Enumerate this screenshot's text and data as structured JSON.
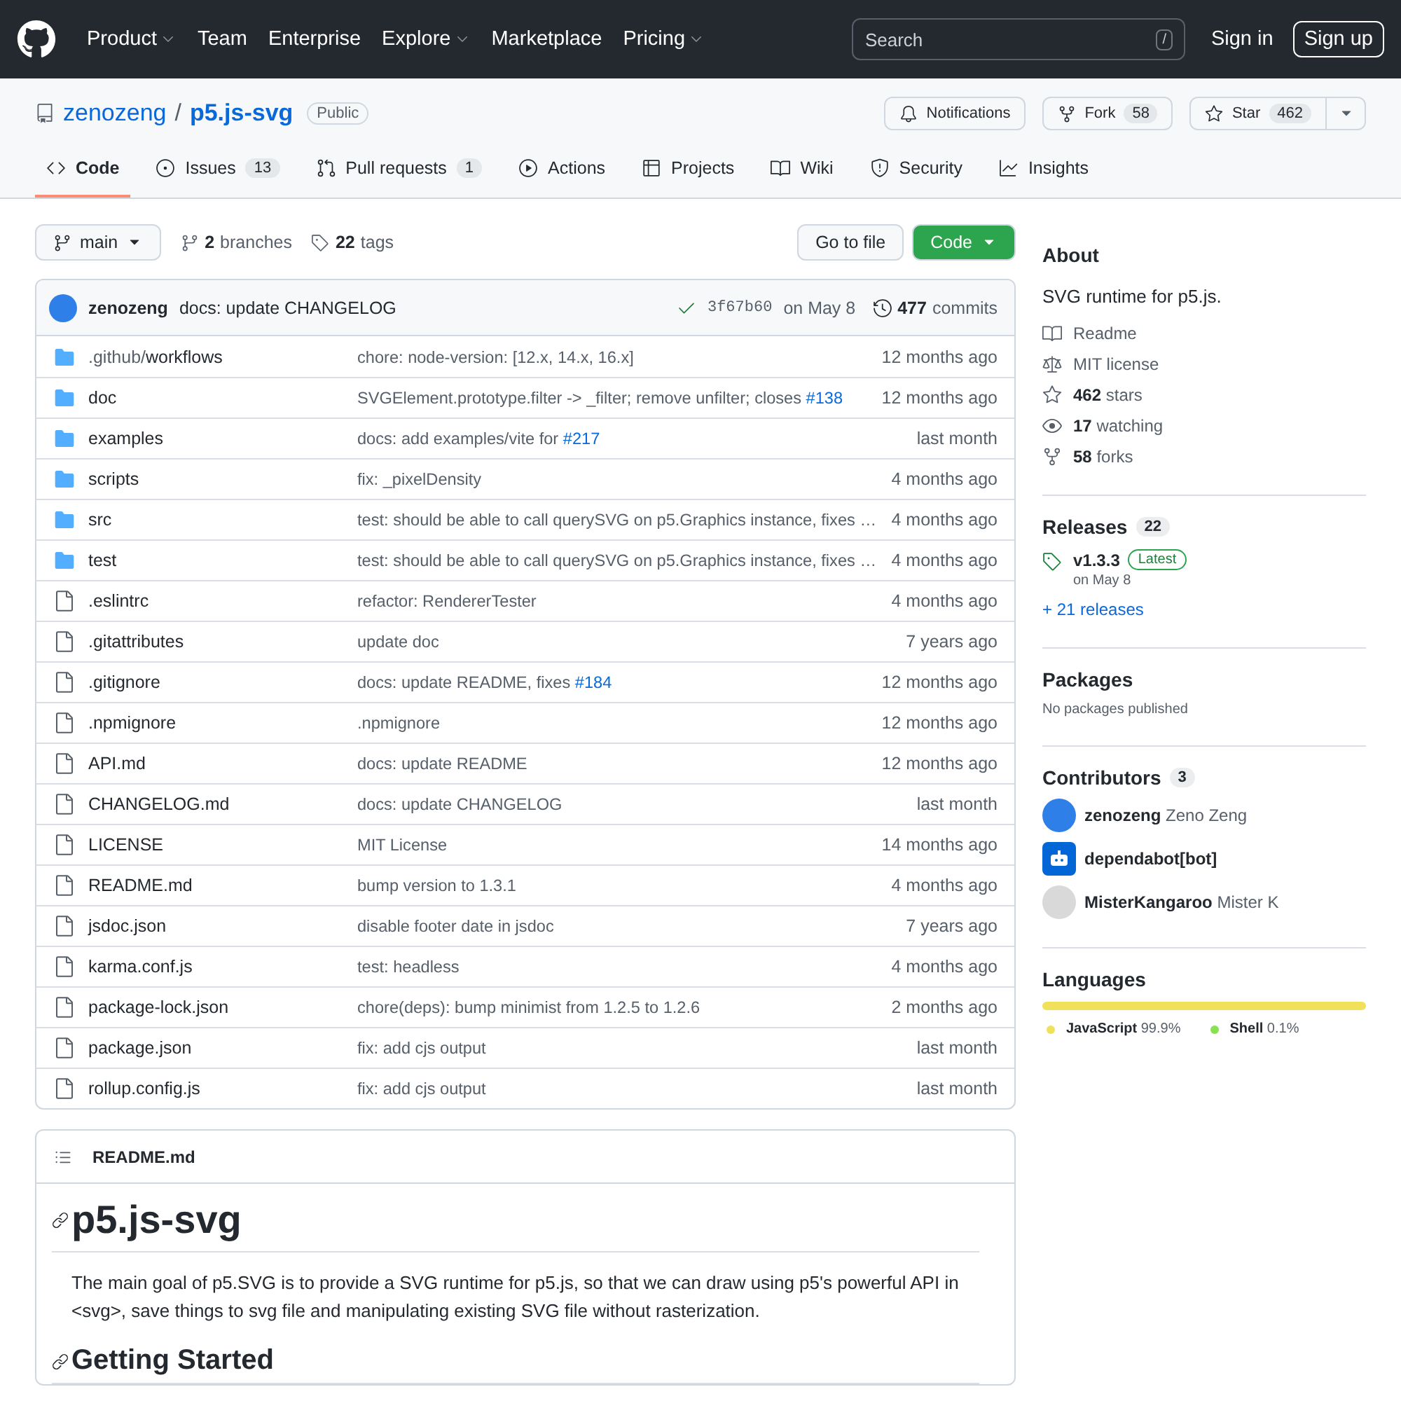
{
  "header": {
    "nav": [
      {
        "label": "Product",
        "dropdown": true
      },
      {
        "label": "Team",
        "dropdown": false
      },
      {
        "label": "Enterprise",
        "dropdown": false
      },
      {
        "label": "Explore",
        "dropdown": true
      },
      {
        "label": "Marketplace",
        "dropdown": false
      },
      {
        "label": "Pricing",
        "dropdown": true
      }
    ],
    "search": {
      "placeholder": "Search",
      "key": "/"
    },
    "sign_in": "Sign in",
    "sign_up": "Sign up"
  },
  "repo": {
    "owner": "zenozeng",
    "separator": "/",
    "name": "p5.js-svg",
    "visibility": "Public",
    "actions": [
      {
        "kind": "notifications",
        "label": "Notifications"
      },
      {
        "kind": "fork",
        "label": "Fork",
        "count": "58"
      },
      {
        "kind": "star",
        "label": "Star",
        "count": "462",
        "menu": true
      }
    ]
  },
  "tabs": [
    {
      "kind": "code",
      "label": "Code",
      "selected": true
    },
    {
      "kind": "issues",
      "label": "Issues",
      "count": "13",
      "selected": false
    },
    {
      "kind": "pulls",
      "label": "Pull requests",
      "count": "1",
      "selected": false
    },
    {
      "kind": "actions",
      "label": "Actions",
      "selected": false
    },
    {
      "kind": "projects",
      "label": "Projects",
      "selected": false
    },
    {
      "kind": "wiki",
      "label": "Wiki",
      "selected": false
    },
    {
      "kind": "security",
      "label": "Security",
      "selected": false
    },
    {
      "kind": "insights",
      "label": "Insights",
      "selected": false
    }
  ],
  "toolbar": {
    "branch": "main",
    "branches": {
      "count": "2",
      "label": "branches"
    },
    "tags": {
      "count": "22",
      "label": "tags"
    },
    "go_to_file": "Go to file",
    "code_button": "Code"
  },
  "commit": {
    "author": "zenozeng",
    "message": "docs: update CHANGELOG",
    "sha": "3f67b60",
    "date": "on May 8",
    "count": "477",
    "count_label": "commits"
  },
  "files": [
    {
      "kind": "dir",
      "prefix": ".github/",
      "name": "workflows",
      "message": "chore: node-version: [12.x, 14.x, 16.x]",
      "time": "12 months ago"
    },
    {
      "kind": "dir",
      "name": "doc",
      "message": "SVGElement.prototype.filter -> _filter; remove unfilter; closes ",
      "link": "#138",
      "time": "12 months ago"
    },
    {
      "kind": "dir",
      "name": "examples",
      "message": "docs: add examples/vite for ",
      "link": "#217",
      "time": "last month"
    },
    {
      "kind": "dir",
      "name": "scripts",
      "message": "fix: _pixelDensity",
      "time": "4 months ago"
    },
    {
      "kind": "dir",
      "name": "src",
      "message": "test: should be able to call querySVG on p5.Graphics instance, fixes …",
      "time": "4 months ago"
    },
    {
      "kind": "dir",
      "name": "test",
      "message": "test: should be able to call querySVG on p5.Graphics instance, fixes …",
      "time": "4 months ago"
    },
    {
      "kind": "file",
      "name": ".eslintrc",
      "message": "refactor: RendererTester",
      "time": "4 months ago"
    },
    {
      "kind": "file",
      "name": ".gitattributes",
      "message": "update doc",
      "time": "7 years ago"
    },
    {
      "kind": "file",
      "name": ".gitignore",
      "message": "docs: update README, fixes ",
      "link": "#184",
      "time": "12 months ago"
    },
    {
      "kind": "file",
      "name": ".npmignore",
      "message": ".npmignore",
      "time": "12 months ago"
    },
    {
      "kind": "file",
      "name": "API.md",
      "message": "docs: update README",
      "time": "12 months ago"
    },
    {
      "kind": "file",
      "name": "CHANGELOG.md",
      "message": "docs: update CHANGELOG",
      "time": "last month"
    },
    {
      "kind": "file",
      "name": "LICENSE",
      "message": "MIT License",
      "time": "14 months ago"
    },
    {
      "kind": "file",
      "name": "README.md",
      "message": "bump version to 1.3.1",
      "time": "4 months ago"
    },
    {
      "kind": "file",
      "name": "jsdoc.json",
      "message": "disable footer date in jsdoc",
      "time": "7 years ago"
    },
    {
      "kind": "file",
      "name": "karma.conf.js",
      "message": "test: headless",
      "time": "4 months ago"
    },
    {
      "kind": "file",
      "name": "package-lock.json",
      "message": "chore(deps): bump minimist from 1.2.5 to 1.2.6",
      "time": "2 months ago"
    },
    {
      "kind": "file",
      "name": "package.json",
      "message": "fix: add cjs output",
      "time": "last month"
    },
    {
      "kind": "file",
      "name": "rollup.config.js",
      "message": "fix: add cjs output",
      "time": "last month"
    }
  ],
  "readme": {
    "filename": "README.md",
    "title": "p5.js-svg",
    "paragraph": "The main goal of p5.SVG is to provide a SVG runtime for p5.js, so that we can draw using p5's powerful API in <svg>, save things to svg file and manipulating existing SVG file without rasterization.",
    "subtitle": "Getting Started"
  },
  "sidebar": {
    "about": {
      "title": "About",
      "description": "SVG runtime for p5.js.",
      "links": [
        {
          "kind": "readme",
          "text": "Readme"
        },
        {
          "kind": "license",
          "text": "MIT license"
        },
        {
          "kind": "stars",
          "strong": "462",
          "text": "stars"
        },
        {
          "kind": "watching",
          "strong": "17",
          "text": "watching"
        },
        {
          "kind": "forks",
          "strong": "58",
          "text": "forks"
        }
      ]
    },
    "releases": {
      "title": "Releases",
      "count": "22",
      "version": "v1.3.3",
      "badge": "Latest",
      "date": "on May 8",
      "more": "+ 21 releases"
    },
    "packages": {
      "title": "Packages",
      "text": "No packages published"
    },
    "contributors": {
      "title": "Contributors",
      "count": "3",
      "items": [
        {
          "kind": "user",
          "login": "zenozeng",
          "name": "Zeno Zeng",
          "color": "#2f7fe8"
        },
        {
          "kind": "bot",
          "login": "dependabot[bot]",
          "color": "#0366d6"
        },
        {
          "kind": "user",
          "login": "MisterKangaroo",
          "name": "Mister K",
          "color": "#d9d9d9"
        }
      ]
    },
    "languages": {
      "title": "Languages",
      "items": [
        {
          "name": "JavaScript",
          "percent": "99.9%",
          "color": "#f1e05a",
          "level": 0.999
        },
        {
          "name": "Shell",
          "percent": "0.1%",
          "color": "#89e051",
          "level": 0.001
        }
      ]
    }
  }
}
